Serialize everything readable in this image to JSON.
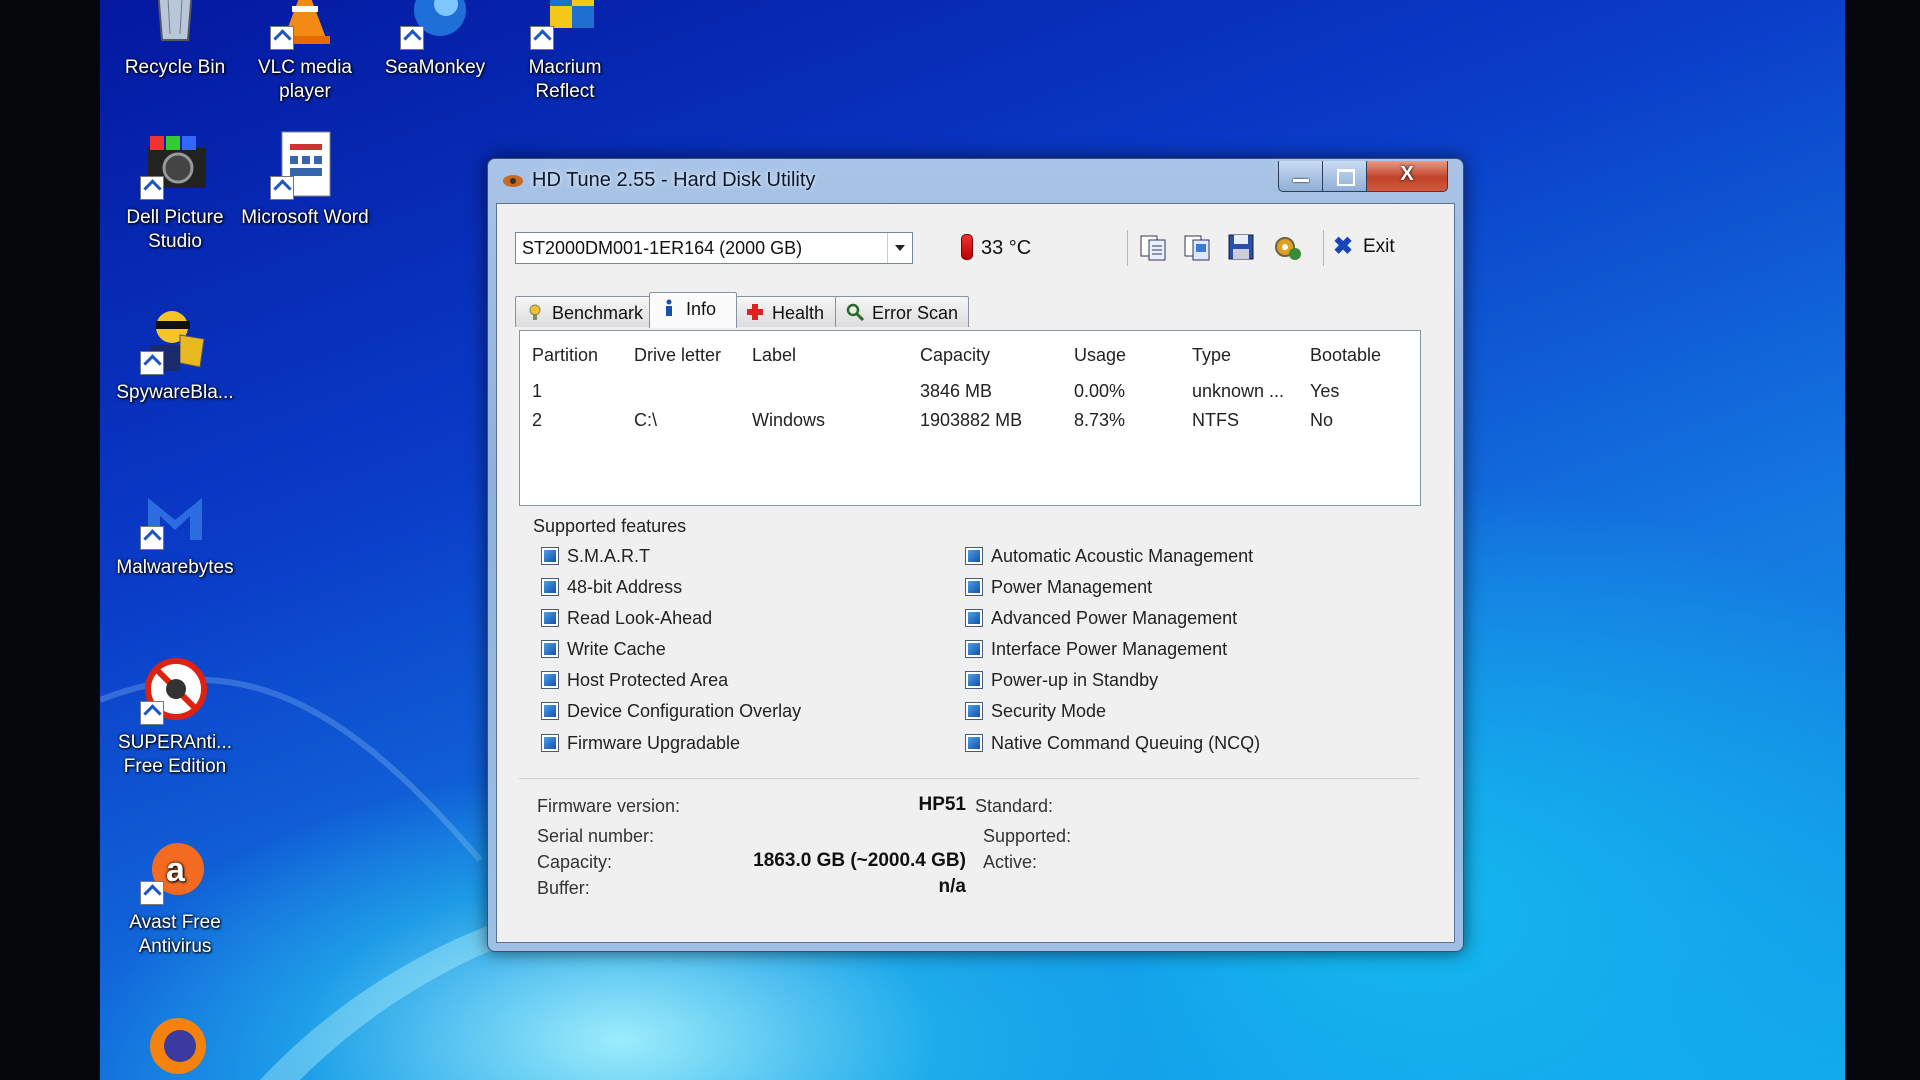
{
  "desktop": {
    "icons": [
      {
        "label": "Recycle Bin"
      },
      {
        "label": "VLC media player"
      },
      {
        "label": "SeaMonkey"
      },
      {
        "label": "Macrium Reflect"
      },
      {
        "label": "Dell Picture Studio"
      },
      {
        "label": "Microsoft Word"
      },
      {
        "label": "SpywareBla..."
      },
      {
        "label": "Malwarebytes"
      },
      {
        "label": "SUPERAnti... Free Edition"
      },
      {
        "label": "Avast Free Antivirus"
      }
    ]
  },
  "window": {
    "title": "HD Tune 2.55 - Hard Disk Utility",
    "controls": {
      "minimize": "",
      "maximize": "",
      "close": "X"
    }
  },
  "toolbar": {
    "drive": "ST2000DM001-1ER164 (2000 GB)",
    "temperature": "33 °C",
    "exit_label": "Exit",
    "icons": [
      "copy-text-icon",
      "copy-screenshot-icon",
      "save-icon",
      "options-icon"
    ]
  },
  "tabs": [
    {
      "label": "Benchmark",
      "icon": "benchmark-icon"
    },
    {
      "label": "Info",
      "icon": "info-icon",
      "active": true
    },
    {
      "label": "Health",
      "icon": "health-icon"
    },
    {
      "label": "Error Scan",
      "icon": "error-scan-icon"
    }
  ],
  "partitions": {
    "columns": [
      "Partition",
      "Drive letter",
      "Label",
      "Capacity",
      "Usage",
      "Type",
      "Bootable"
    ],
    "rows": [
      [
        "1",
        "",
        "",
        "3846 MB",
        "0.00%",
        "unknown ...",
        "Yes"
      ],
      [
        "2",
        "C:\\",
        "Windows",
        "1903882 MB",
        "8.73%",
        "NTFS",
        "No"
      ]
    ]
  },
  "features": {
    "label": "Supported features",
    "left": [
      "S.M.A.R.T",
      "48-bit Address",
      "Read Look-Ahead",
      "Write Cache",
      "Host Protected Area",
      "Device Configuration Overlay",
      "Firmware Upgradable"
    ],
    "right": [
      "Automatic Acoustic Management",
      "Power Management",
      "Advanced Power Management",
      "Interface Power Management",
      "Power-up in Standby",
      "Security Mode",
      "Native Command Queuing (NCQ)"
    ]
  },
  "details": {
    "firmware_label": "Firmware version:",
    "firmware_value": "HP51",
    "serial_label": "Serial number:",
    "serial_value": "",
    "capacity_label": "Capacity:",
    "capacity_value": "1863.0 GB (~2000.4 GB)",
    "buffer_label": "Buffer:",
    "buffer_value": "n/a",
    "standard_label": "Standard:",
    "supported_label": "Supported:",
    "active_label": "Active:"
  }
}
